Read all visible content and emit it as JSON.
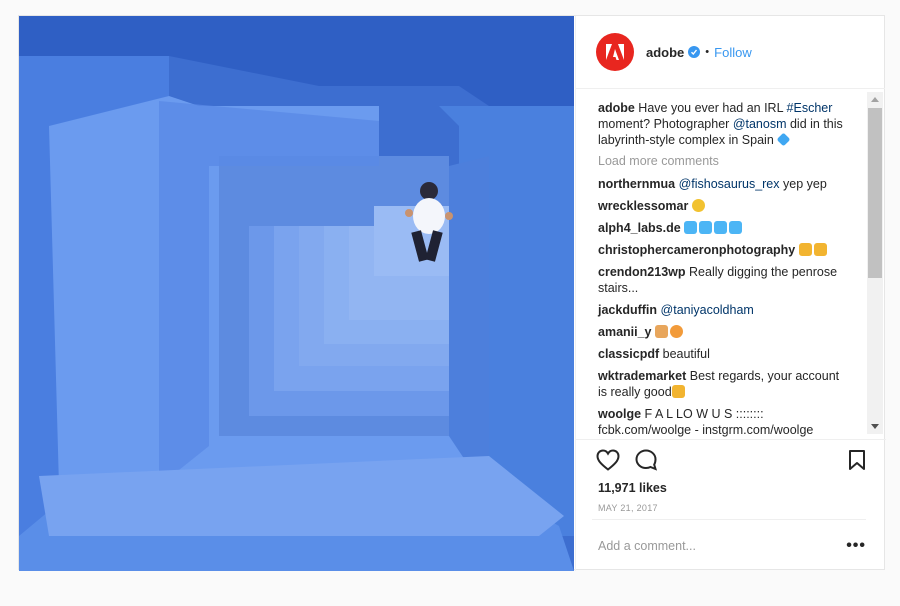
{
  "post": {
    "image_alt": "blue labyrinth staircase",
    "colors": {
      "brand": "#e8261f",
      "link": "#3897f0",
      "hashtag": "#003569",
      "photo": "#3b6fd1"
    }
  },
  "header": {
    "username": "adobe",
    "separator": "•",
    "follow_label": "Follow",
    "avatar_icon": "adobe-logo-icon",
    "verified_icon": "verified-badge-icon"
  },
  "caption": {
    "user": "adobe",
    "text_1": "Have you ever had an IRL ",
    "hashtag": "#Escher",
    "text_2": " moment? Photographer ",
    "mention": "@tanosm",
    "text_3": " did in this labyrinth-style complex in Spain"
  },
  "load_more": "Load more comments",
  "comments": [
    {
      "user": "northernmua",
      "mention": "@fishosaurus_rex",
      "text": " yep yep"
    },
    {
      "user": "wrecklessomar",
      "mention": "",
      "text": ""
    },
    {
      "user": "alph4_labs.de",
      "mention": "",
      "text": ""
    },
    {
      "user": "christophercameronphotography",
      "mention": "",
      "text": ""
    },
    {
      "user": "crendon213wp",
      "mention": "",
      "text": "Really digging the penrose stairs..."
    },
    {
      "user": "jackduffin",
      "mention": "@taniyacoldham",
      "text": ""
    },
    {
      "user": "amanii_y",
      "mention": "",
      "text": ""
    },
    {
      "user": "classicpdf",
      "mention": "",
      "text": "beautiful"
    },
    {
      "user": "wktrademarket",
      "mention": "",
      "text": "Best regards, your account is really good"
    },
    {
      "user": "woolge",
      "mention": "",
      "text": "F A L LO W U S :::::::: fcbk.com/woolge - instgrm.com/woolge"
    }
  ],
  "actions": {
    "like_icon": "heart-icon",
    "comment_icon": "comment-bubble-icon",
    "save_icon": "bookmark-icon"
  },
  "likes": "11,971 likes",
  "date": "MAY 21, 2017",
  "add_comment": {
    "placeholder": "Add a comment..."
  },
  "more_label": "•••"
}
